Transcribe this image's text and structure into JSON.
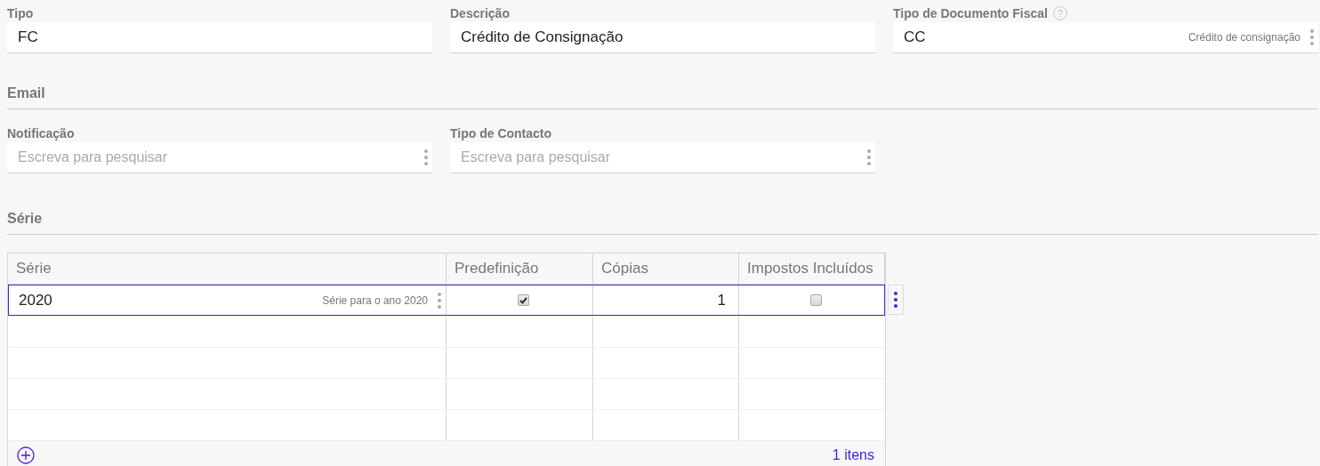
{
  "fields": [
    {
      "label": "Tipo",
      "value": "FC",
      "menu": false
    },
    {
      "label": "Descrição",
      "value": "Crédito de Consignação",
      "menu": false
    },
    {
      "label": "Tipo de Documento Fiscal",
      "help": "?",
      "value": "CC",
      "detail": "Crédito de consignação",
      "menu": true
    }
  ],
  "email": {
    "heading": "Email",
    "fields": [
      {
        "label": "Notificação",
        "placeholder": "Escreva para pesquisar",
        "menu": true
      },
      {
        "label": "Tipo de Contacto",
        "placeholder": "Escreva para pesquisar",
        "menu": true
      }
    ]
  },
  "serie": {
    "heading": "Série",
    "table": {
      "columns": [
        "Série",
        "Predefinição",
        "Cópias",
        "Impostos Incluídos"
      ],
      "rows": [
        {
          "serie": "2020",
          "detail": "Série para o ano 2020",
          "default": true,
          "copies": "1",
          "taxes_included": false,
          "selected": true
        }
      ],
      "count": "1 itens"
    }
  }
}
